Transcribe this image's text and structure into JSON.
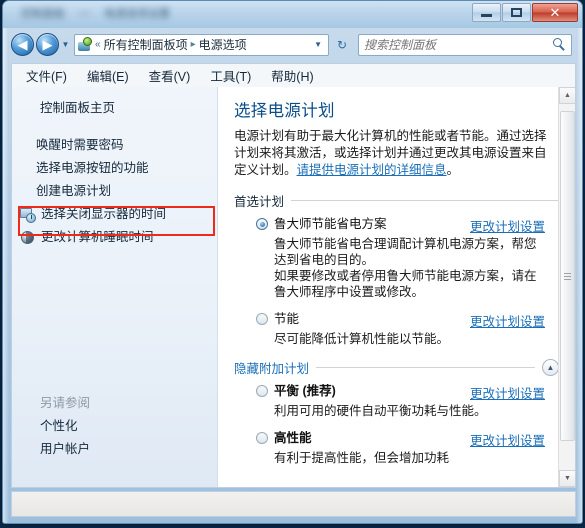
{
  "window": {
    "title_blurred_a": "控制面板",
    "title_blurred_b": "—",
    "title_blurred_c": "电源选项设置",
    "minimize_label": "最小化",
    "maximize_label": "最大化",
    "close_label": "✕"
  },
  "toolbar": {
    "back_label": "◀",
    "forward_label": "▶",
    "history_caret": "▼",
    "refresh_label": "↻",
    "address": {
      "icon": "control-panel-icon",
      "overflow": "«",
      "crumbs": [
        "所有控制面板项",
        "电源选项"
      ],
      "separator": "▸",
      "caret": "▼"
    },
    "search": {
      "placeholder": "搜索控制面板",
      "value": "",
      "icon": "search-icon"
    }
  },
  "menubar": {
    "items": [
      {
        "label": "文件(F)"
      },
      {
        "label": "编辑(E)"
      },
      {
        "label": "查看(V)"
      },
      {
        "label": "工具(T)"
      },
      {
        "label": "帮助(H)"
      }
    ]
  },
  "sidebar": {
    "home": {
      "label": "控制面板主页"
    },
    "items": [
      {
        "label": "唤醒时需要密码",
        "icon": null
      },
      {
        "label": "选择电源按钮的功能",
        "icon": null
      },
      {
        "label": "创建电源计划",
        "icon": null
      },
      {
        "label": "选择关闭显示器的时间",
        "icon": "monitor-clock-icon"
      },
      {
        "label": "更改计算机睡眠时间",
        "icon": "sleep-icon",
        "highlighted": true
      }
    ],
    "see_also": {
      "title": "另请参阅",
      "items": [
        {
          "label": "个性化"
        },
        {
          "label": "用户帐户"
        }
      ]
    }
  },
  "main": {
    "title": "选择电源计划",
    "description_part1": "电源计划有助于最大化计算机的性能或者节能。通过选择计划来将其激活，或选择计划并通过更改其电源设置来自定义计划。",
    "description_link": "请提供电源计划的详细信息",
    "description_end": "。",
    "preferred_section": {
      "label": "首选计划"
    },
    "hidden_section": {
      "label": "隐藏附加计划",
      "collapse_icon": "chevron-up-icon"
    },
    "change_settings_label": "更改计划设置",
    "plans": [
      {
        "name": "鲁大师节能省电方案",
        "selected": true,
        "bold": false,
        "description": "鲁大师节能省电合理调配计算机电源方案，帮您达到省电的目的。\n如果要修改或者停用鲁大师节能电源方案，请在鲁大师程序中设置或修改。",
        "link": "更改计划设置",
        "group": "preferred"
      },
      {
        "name": "节能",
        "selected": false,
        "bold": false,
        "description": "尽可能降低计算机性能以节能。",
        "link": "更改计划设置",
        "group": "preferred"
      },
      {
        "name": "平衡 (推荐)",
        "selected": false,
        "bold": true,
        "description": "利用可用的硬件自动平衡功耗与性能。",
        "link": "更改计划设置",
        "group": "additional"
      },
      {
        "name": "高性能",
        "selected": false,
        "bold": true,
        "description": "有利于提高性能，但会增加功耗",
        "link": "更改计划设置",
        "group": "additional"
      }
    ]
  },
  "scrollbar": {
    "up_arrow": "▲",
    "down_arrow": "▼"
  },
  "statusbar": {
    "text": ""
  },
  "colors": {
    "accent_link": "#1a6fb8",
    "title_heading": "#0b4d8a",
    "highlight_box": "#ee2b18",
    "close_button": "#bc3d2c"
  }
}
